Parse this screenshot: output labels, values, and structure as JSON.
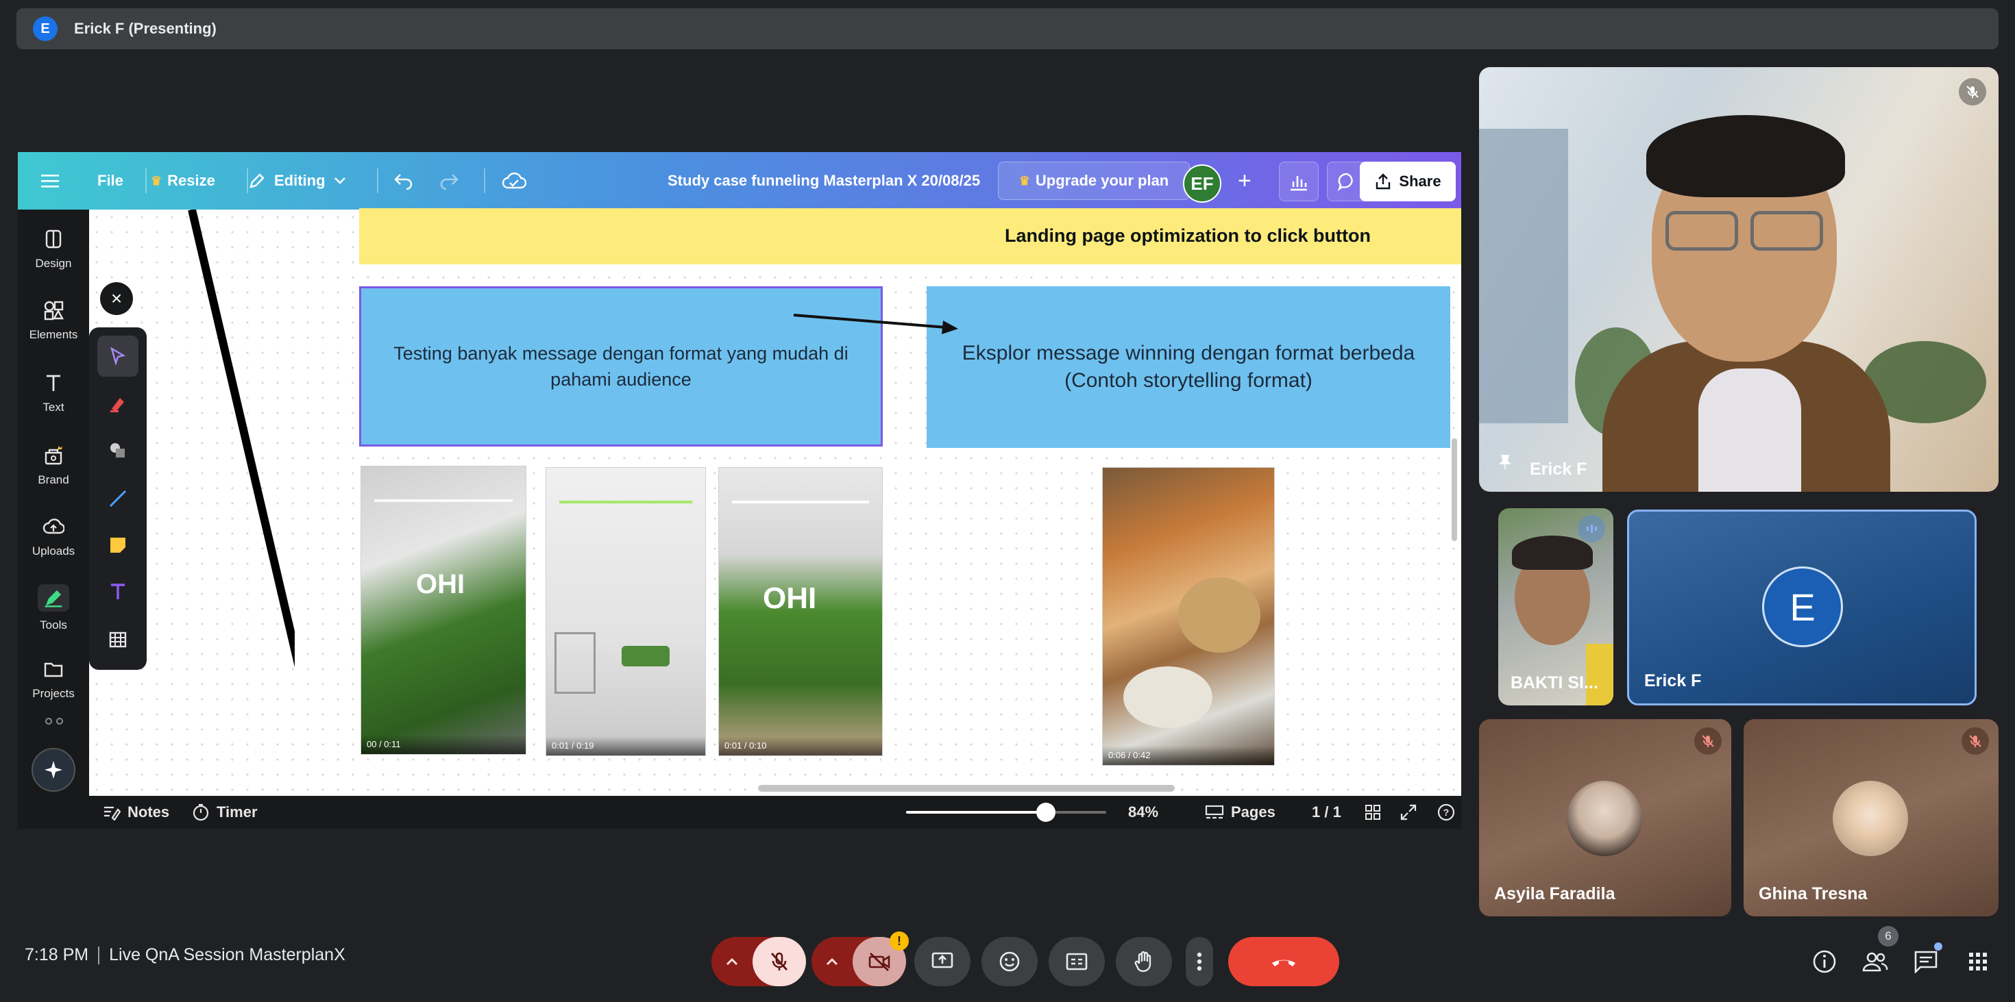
{
  "presenting": {
    "avatar_letter": "E",
    "label": "Erick F (Presenting)"
  },
  "canva": {
    "menu": {
      "file": "File",
      "resize": "Resize",
      "editing": "Editing"
    },
    "doc_title": "Study case funneling Masterplan X 20/08/25",
    "upgrade": "Upgrade your plan",
    "user_initials": "EF",
    "share": "Share",
    "sidebar": [
      {
        "label": "Design",
        "icon": "design-icon"
      },
      {
        "label": "Elements",
        "icon": "elements-icon"
      },
      {
        "label": "Text",
        "icon": "text-icon"
      },
      {
        "label": "Brand",
        "icon": "brand-icon"
      },
      {
        "label": "Uploads",
        "icon": "uploads-icon"
      },
      {
        "label": "Tools",
        "icon": "tools-icon"
      },
      {
        "label": "Projects",
        "icon": "projects-icon"
      }
    ],
    "canvas": {
      "banner_text": "Landing page optimization to click button",
      "box_left": "Testing banyak message dengan format  yang mudah di pahami audience",
      "box_right": "Eksplor message winning dengan format berbeda (Contoh storytelling format)",
      "thumbs": [
        {
          "time": "00 / 0:11"
        },
        {
          "time": "0:01 / 0:19"
        },
        {
          "time": "0:01 / 0:10"
        },
        {
          "time": "0:06 / 0:42"
        }
      ]
    },
    "bottom": {
      "notes": "Notes",
      "timer": "Timer",
      "zoom": "84%",
      "pages_label": "Pages",
      "page_count": "1 / 1",
      "zoom_level": 0.7
    }
  },
  "participants": [
    {
      "name": "Erick F",
      "role": "speaker"
    },
    {
      "name": "BAKTI SI...",
      "role": "tile"
    },
    {
      "name": "Erick F",
      "avatar_letter": "E",
      "role": "tile"
    },
    {
      "name": "Asyila Faradila",
      "role": "tile",
      "muted": true
    },
    {
      "name": "Ghina Tresna",
      "role": "tile",
      "muted": true
    }
  ],
  "meeting": {
    "time": "7:18 PM",
    "title": "Live QnA Session MasterplanX",
    "people_count": "6"
  },
  "colors": {
    "meet_bg": "#202124",
    "hangup": "#ea4335",
    "mic_off": "#f9dedc",
    "canva_gradient_start": "#3fc8d2",
    "canva_gradient_end": "#7b5ae8",
    "banner_yellow": "#fdeb7b",
    "box_blue": "#6ec1ef"
  }
}
